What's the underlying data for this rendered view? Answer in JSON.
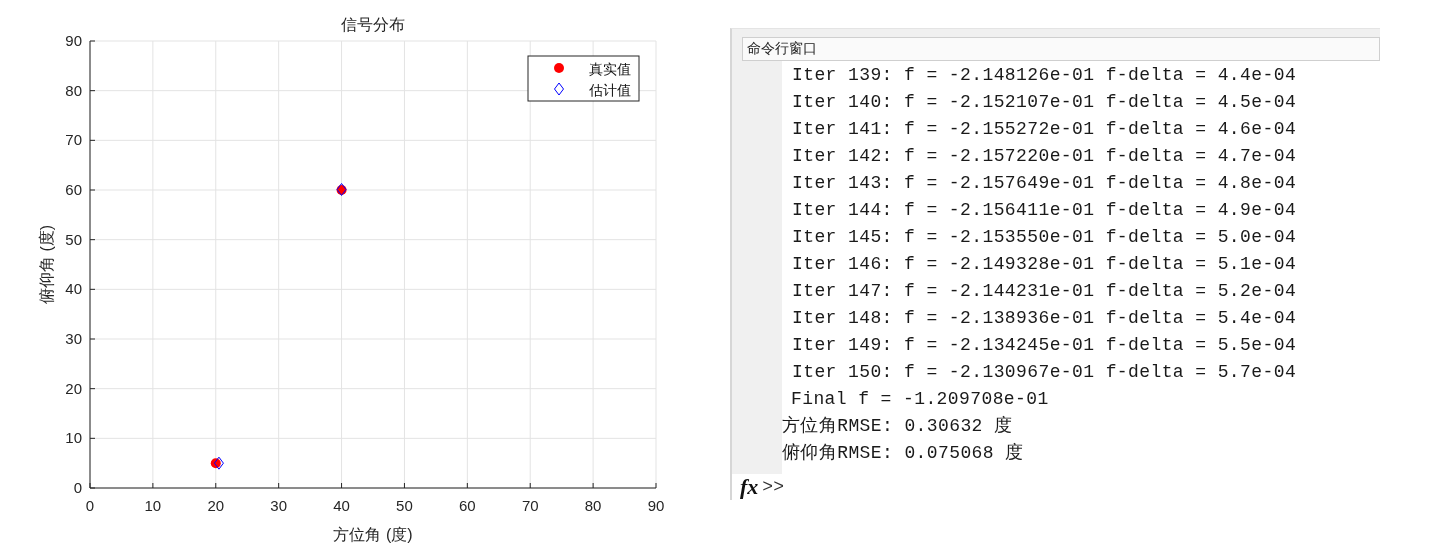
{
  "figure": {
    "chart_data": {
      "type": "scatter",
      "title": "信号分布",
      "xlabel": "方位角 (度)",
      "ylabel": "俯仰角 (度)",
      "xlim": [
        0,
        90
      ],
      "ylim": [
        0,
        90
      ],
      "grid": true,
      "legend": "upper right",
      "xticks": [
        0,
        10,
        20,
        30,
        40,
        50,
        60,
        70,
        80,
        90
      ],
      "yticks": [
        0,
        10,
        20,
        30,
        40,
        50,
        60,
        70,
        80,
        90
      ],
      "series": [
        {
          "name": "真实值",
          "color": "#ff0000",
          "x": [
            20,
            40
          ],
          "values": [
            5,
            60
          ]
        },
        {
          "name": "估计值",
          "color": "#0000ff",
          "x": [
            20.5,
            40
          ],
          "values": [
            5,
            60.1
          ]
        }
      ]
    }
  },
  "command_window": {
    "title": "命令行窗口",
    "lines": [
      {
        "kind": "iter",
        "text": "Iter 139: f = -2.148126e-01 f-delta = 4.4e-04"
      },
      {
        "kind": "iter",
        "text": "Iter 140: f = -2.152107e-01 f-delta = 4.5e-04"
      },
      {
        "kind": "iter",
        "text": "Iter 141: f = -2.155272e-01 f-delta = 4.6e-04"
      },
      {
        "kind": "iter",
        "text": "Iter 142: f = -2.157220e-01 f-delta = 4.7e-04"
      },
      {
        "kind": "iter",
        "text": "Iter 143: f = -2.157649e-01 f-delta = 4.8e-04"
      },
      {
        "kind": "iter",
        "text": "Iter 144: f = -2.156411e-01 f-delta = 4.9e-04"
      },
      {
        "kind": "iter",
        "text": "Iter 145: f = -2.153550e-01 f-delta = 5.0e-04"
      },
      {
        "kind": "iter",
        "text": "Iter 146: f = -2.149328e-01 f-delta = 5.1e-04"
      },
      {
        "kind": "iter",
        "text": "Iter 147: f = -2.144231e-01 f-delta = 5.2e-04"
      },
      {
        "kind": "iter",
        "text": "Iter 148: f = -2.138936e-01 f-delta = 5.4e-04"
      },
      {
        "kind": "iter",
        "text": "Iter 149: f = -2.134245e-01 f-delta = 5.5e-04"
      },
      {
        "kind": "iter",
        "text": "Iter 150: f = -2.130967e-01 f-delta = 5.7e-04"
      },
      {
        "kind": "final",
        "text": "Final f = -1.209708e-01"
      },
      {
        "kind": "result",
        "text": "方位角RMSE: 0.30632 度"
      },
      {
        "kind": "result",
        "text": "俯仰角RMSE: 0.075068 度"
      }
    ],
    "function_icon": "fx",
    "prompt": ">>"
  }
}
